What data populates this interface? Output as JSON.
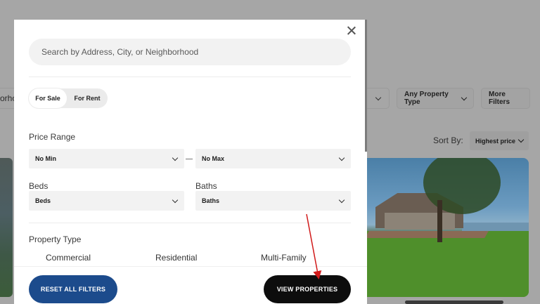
{
  "background": {
    "left_filter_stub": "orho",
    "property_type_filter": "Any Property Type",
    "more_filters_button": "More Filters",
    "sort_label": "Sort By:",
    "sort_value": "Highest price"
  },
  "modal": {
    "search": {
      "placeholder": "Search by Address, City, or Neighborhood",
      "value": ""
    },
    "listing_toggle": {
      "options": [
        "For Sale",
        "For Rent"
      ],
      "selected": "For Sale"
    },
    "price_range": {
      "label": "Price Range",
      "min_value": "No Min",
      "max_value": "No Max",
      "separator": "—"
    },
    "beds": {
      "label": "Beds",
      "value": "Beds"
    },
    "baths": {
      "label": "Baths",
      "value": "Baths"
    },
    "property_type": {
      "label": "Property Type",
      "options": [
        "Commercial",
        "Residential",
        "Multi-Family"
      ]
    },
    "footer": {
      "reset_label": "RESET ALL FILTERS",
      "view_label": "VIEW PROPERTIES"
    }
  },
  "colors": {
    "reset_button": "#1c4b8c",
    "view_button": "#0d0d0d",
    "annotation_arrow": "#d11a1a"
  }
}
